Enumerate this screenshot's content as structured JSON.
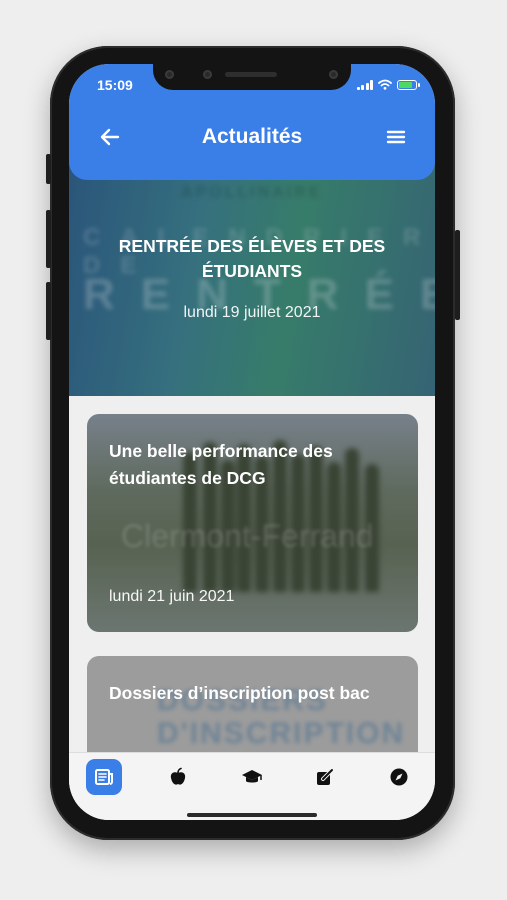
{
  "status_bar": {
    "time": "15:09"
  },
  "header": {
    "title": "Actualités",
    "back_icon": "arrow-left-icon",
    "menu_icon": "hamburger-menu-icon"
  },
  "colors": {
    "primary": "#3a7ee8",
    "background": "#efefef",
    "battery_charge": "#4cd964"
  },
  "news": {
    "featured": {
      "title": "RENTRÉE DES ÉLÈVES ET DES ÉTUDIANTS",
      "date": "lundi 19 juillet 2021"
    },
    "items": [
      {
        "title": "Une belle performance des étudiantes de DCG",
        "date": "lundi 21 juin 2021"
      },
      {
        "title": "Dossiers d’inscription post bac"
      }
    ]
  },
  "tab_bar": {
    "tabs": [
      {
        "icon": "newspaper-icon",
        "active": true
      },
      {
        "icon": "apple-icon",
        "active": false
      },
      {
        "icon": "graduation-cap-icon",
        "active": false
      },
      {
        "icon": "edit-note-icon",
        "active": false
      },
      {
        "icon": "compass-icon",
        "active": false
      }
    ]
  }
}
